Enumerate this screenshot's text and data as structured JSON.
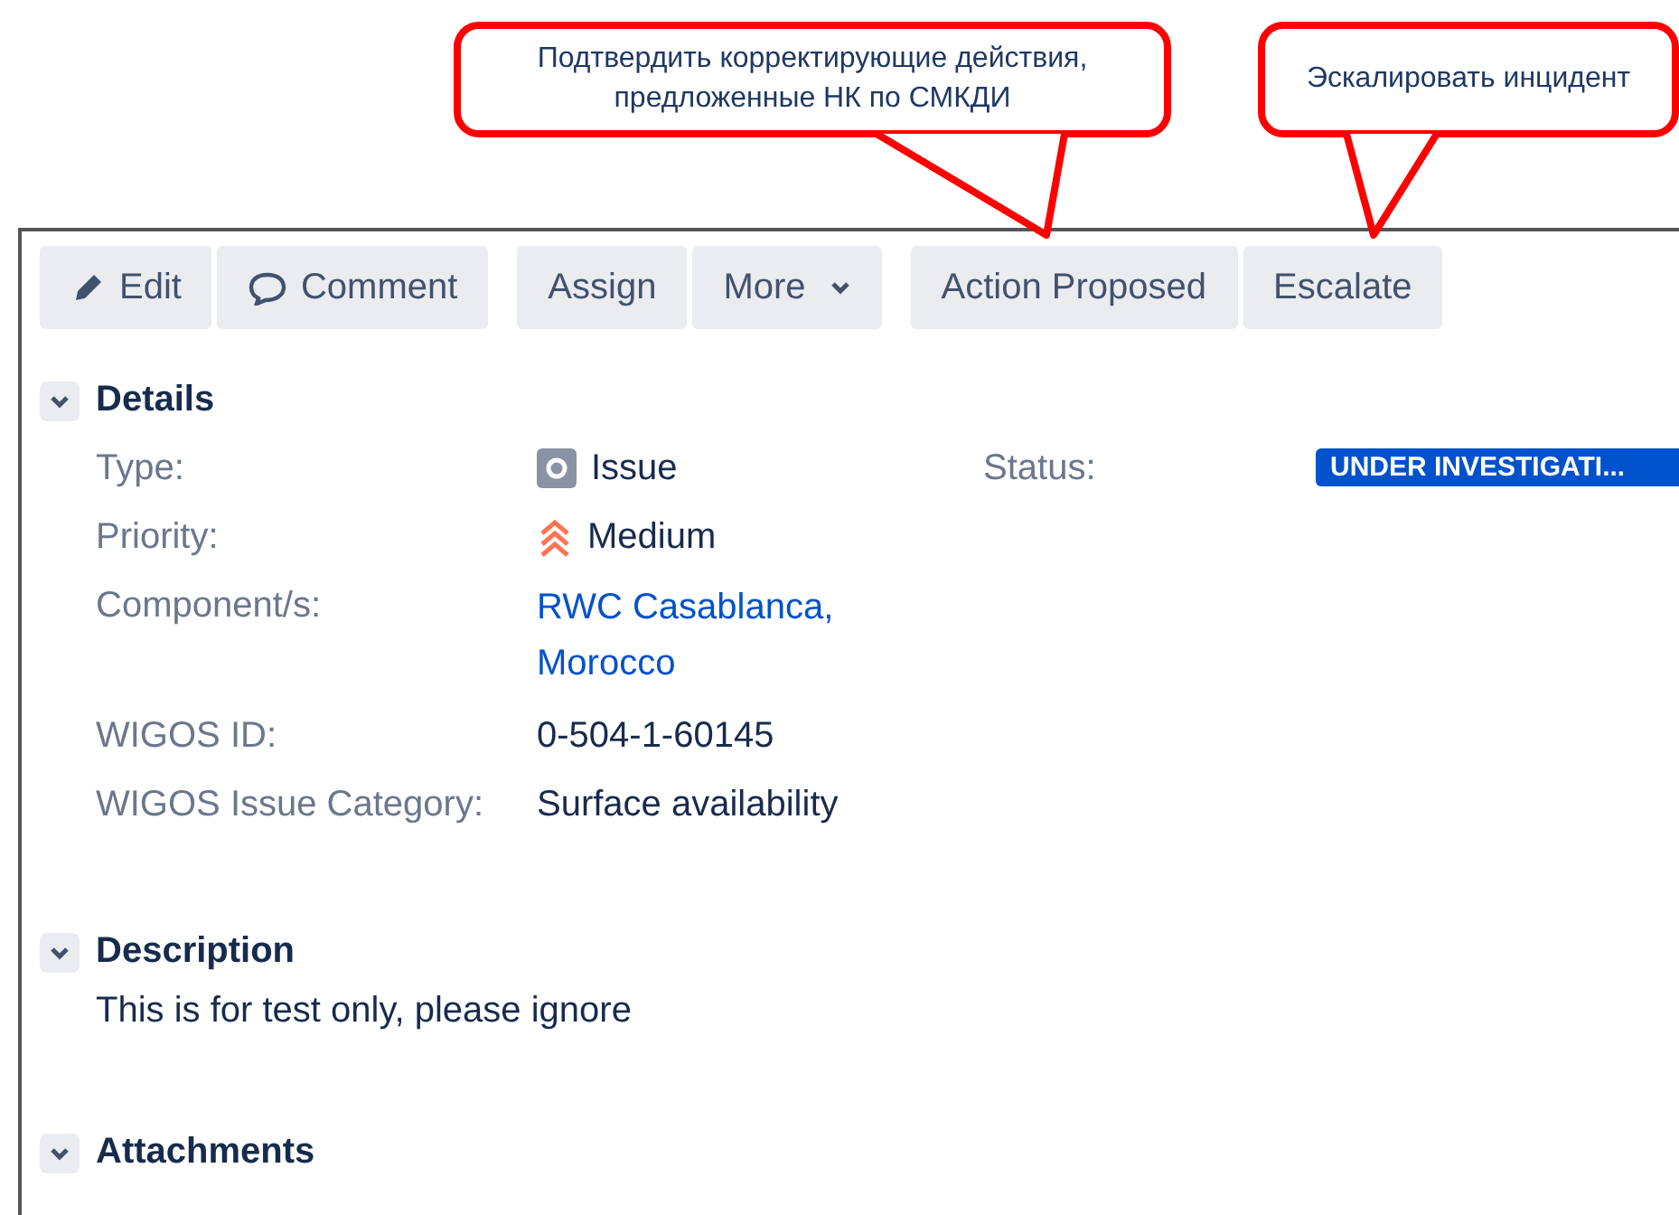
{
  "callouts": [
    {
      "text": "Подтвердить корректирующие действия, предложенные НК по СМКДИ",
      "kind": "long-tail"
    },
    {
      "text": "Эскалировать инцидент",
      "kind": "short-tail"
    }
  ],
  "toolbar": [
    [
      {
        "label": "Edit",
        "kind": "edit"
      },
      {
        "label": "Comment",
        "kind": "comment"
      }
    ],
    [
      {
        "label": "Assign",
        "kind": "plain"
      },
      {
        "label": "More",
        "kind": "menu"
      }
    ],
    [
      {
        "label": "Action Proposed",
        "kind": "plain"
      },
      {
        "label": "Escalate",
        "kind": "plain"
      }
    ]
  ],
  "details": {
    "title": "Details",
    "expanded": true,
    "fields": [
      {
        "label": "Type:",
        "value": "Issue",
        "kind": "type"
      },
      {
        "label": "Priority:",
        "value": "Medium",
        "kind": "priority"
      },
      {
        "label": "Component/s:",
        "value": "RWC Casablanca, Morocco",
        "kind": "link"
      },
      {
        "label": "WIGOS ID:",
        "value": "0-504-1-60145",
        "kind": "text"
      },
      {
        "label": "WIGOS Issue Category:",
        "value": "Surface availability",
        "kind": "text"
      }
    ],
    "status": {
      "label": "Status:",
      "value": "UNDER INVESTIGATI..."
    }
  },
  "description": {
    "title": "Description",
    "expanded": true,
    "text": "This is for test only, please ignore"
  },
  "attachments": {
    "title": "Attachments",
    "expanded": true
  }
}
